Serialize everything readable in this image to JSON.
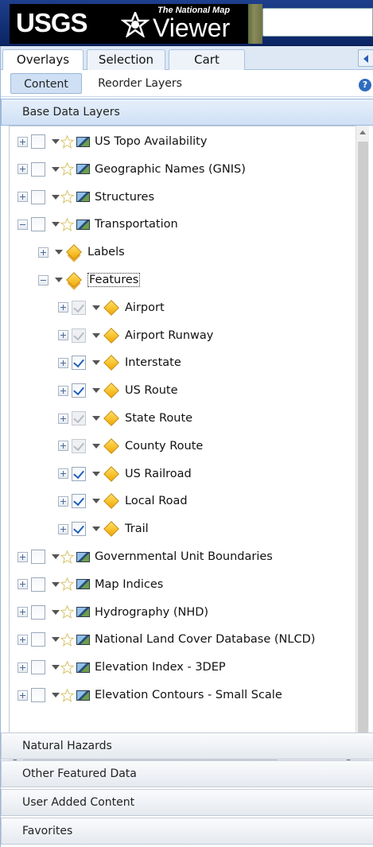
{
  "header": {
    "logo_text": "USGS",
    "product_tag": "The National Map",
    "product_name": "Viewer",
    "search_value": ""
  },
  "tabs": [
    "Overlays",
    "Selection",
    "Cart"
  ],
  "subtabs": [
    "Content",
    "Reorder Layers"
  ],
  "help_icon": "?",
  "sections": {
    "open": "Base Data Layers",
    "collapsed": [
      "Natural Hazards",
      "Other Featured Data",
      "User Added Content",
      "Favorites"
    ]
  },
  "tree": [
    {
      "label": "US Topo Availability",
      "level": 0,
      "expander": "plus",
      "checkbox": "empty",
      "icon": "layer-icon",
      "star": true
    },
    {
      "label": "Geographic Names (GNIS)",
      "level": 0,
      "expander": "plus",
      "checkbox": "empty",
      "icon": "layer-icon",
      "star": true
    },
    {
      "label": "Structures",
      "level": 0,
      "expander": "plus",
      "checkbox": "empty",
      "icon": "layer-icon",
      "star": true
    },
    {
      "label": "Transportation",
      "level": 0,
      "expander": "minus",
      "checkbox": "empty",
      "icon": "layer-icon",
      "star": true
    },
    {
      "label": "Labels",
      "level": 1,
      "expander": "plus",
      "checkbox": "none",
      "icon": "group-diamond-icon",
      "star": false
    },
    {
      "label": "Features",
      "level": 1,
      "expander": "minus",
      "checkbox": "none",
      "icon": "group-diamond-icon",
      "star": false,
      "focused": true
    },
    {
      "label": "Airport",
      "level": 2,
      "expander": "plus",
      "checkbox": "disabled",
      "icon": "diamond-icon",
      "star": false
    },
    {
      "label": "Airport Runway",
      "level": 2,
      "expander": "plus",
      "checkbox": "disabled",
      "icon": "diamond-icon",
      "star": false
    },
    {
      "label": "Interstate",
      "level": 2,
      "expander": "plus",
      "checkbox": "checked",
      "icon": "diamond-icon",
      "star": false
    },
    {
      "label": "US Route",
      "level": 2,
      "expander": "plus",
      "checkbox": "checked",
      "icon": "diamond-icon",
      "star": false
    },
    {
      "label": "State Route",
      "level": 2,
      "expander": "plus",
      "checkbox": "disabled",
      "icon": "diamond-icon",
      "star": false
    },
    {
      "label": "County Route",
      "level": 2,
      "expander": "plus",
      "checkbox": "disabled",
      "icon": "diamond-icon",
      "star": false
    },
    {
      "label": "US Railroad",
      "level": 2,
      "expander": "plus",
      "checkbox": "checked",
      "icon": "diamond-icon",
      "star": false
    },
    {
      "label": "Local Road",
      "level": 2,
      "expander": "plus",
      "checkbox": "checked",
      "icon": "diamond-icon",
      "star": false
    },
    {
      "label": "Trail",
      "level": 2,
      "expander": "plus",
      "checkbox": "checked",
      "icon": "diamond-icon",
      "star": false
    },
    {
      "label": "Governmental Unit Boundaries",
      "level": 0,
      "expander": "plus",
      "checkbox": "empty",
      "icon": "layer-icon",
      "star": true
    },
    {
      "label": "Map Indices",
      "level": 0,
      "expander": "plus",
      "checkbox": "empty",
      "icon": "layer-icon",
      "star": true
    },
    {
      "label": "Hydrography (NHD)",
      "level": 0,
      "expander": "plus",
      "checkbox": "empty",
      "icon": "layer-icon",
      "star": true
    },
    {
      "label": "National Land Cover Database (NLCD)",
      "level": 0,
      "expander": "plus",
      "checkbox": "empty",
      "icon": "layer-icon",
      "star": true
    },
    {
      "label": "Elevation Index - 3DEP",
      "level": 0,
      "expander": "plus",
      "checkbox": "empty",
      "icon": "layer-icon",
      "star": true
    },
    {
      "label": "Elevation Contours - Small Scale",
      "level": 0,
      "expander": "plus",
      "checkbox": "empty",
      "icon": "layer-icon",
      "star": true
    }
  ],
  "colors": {
    "header_bg": "#0b2464",
    "accent": "#1f5fbf",
    "feature_icon": "#f2a800"
  }
}
